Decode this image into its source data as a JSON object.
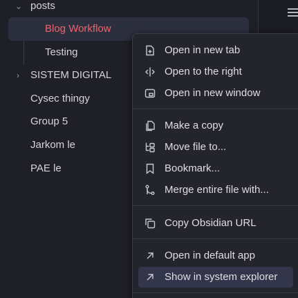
{
  "tree": {
    "folder_posts": "posts",
    "blog_workflow": "Blog Workflow",
    "testing": "Testing",
    "sistem_digital": "SISTEM DIGITAL",
    "cysec": "Cysec thingy",
    "group5": "Group 5",
    "jarkom": "Jarkom le",
    "pae": "PAE le"
  },
  "menu": {
    "open_new_tab": "Open in new tab",
    "open_right": "Open to the right",
    "open_new_window": "Open in new window",
    "make_copy": "Make a copy",
    "move_file": "Move file to...",
    "bookmark": "Bookmark...",
    "merge_file": "Merge entire file with...",
    "copy_url": "Copy Obsidian URL",
    "open_default": "Open in default app",
    "show_explorer": "Show in system explorer"
  },
  "colors": {
    "accent_selected_text": "#f0636e",
    "background": "#1f1f27",
    "menu_background": "#24242d",
    "hover": "#33364a"
  },
  "icons": {
    "open_new_tab": "file-plus-icon",
    "open_right": "split-right-icon",
    "open_new_window": "window-icon",
    "make_copy": "copy-files-icon",
    "move_file": "folder-tree-icon",
    "bookmark": "bookmark-icon",
    "merge_file": "git-merge-icon",
    "copy_url": "copy-icon",
    "open_default": "arrow-up-right-icon",
    "show_explorer": "arrow-up-right-icon"
  }
}
